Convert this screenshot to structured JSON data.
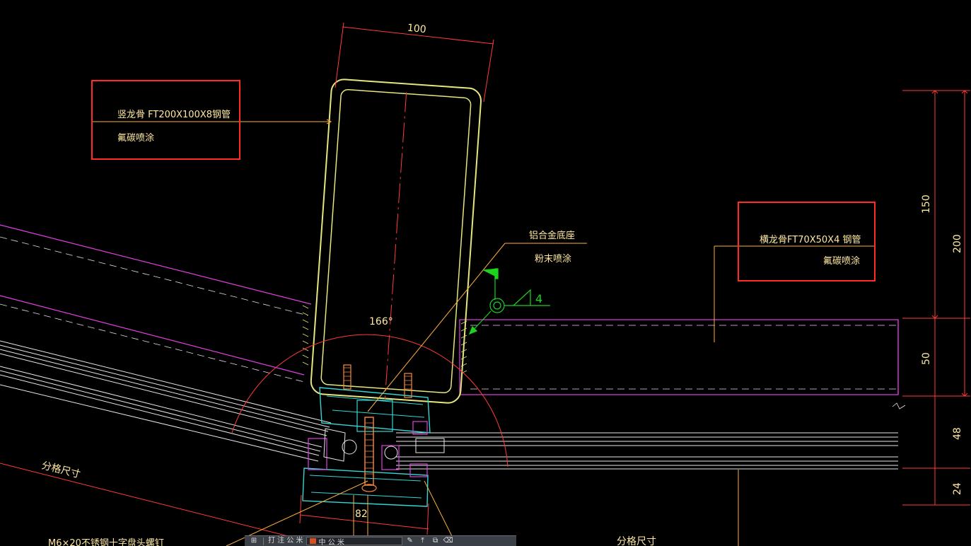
{
  "colors": {
    "background": "#000000",
    "steel": "#e6e67e",
    "dimension": "#ff3a3a",
    "leader": "#ffb13a",
    "text": "#ffe9a0",
    "magenta": "#e040e0",
    "cyan": "#34d6d6",
    "green": "#1bd41b",
    "highlight_box": "#ff2a2a"
  },
  "dimensions": {
    "width_top": "100",
    "angle": "166°",
    "right_150": "150",
    "right_200": "200",
    "right_50": "50",
    "right_48": "48",
    "right_24": "24",
    "bottom_82": "82",
    "weld_size": "4"
  },
  "annotations": {
    "vertical_member_line1": "竖龙骨 FT200X100X8钢管",
    "vertical_member_line2": "氟碳喷涂",
    "horizontal_member_line1": "横龙骨FT70X50X4 钢管",
    "horizontal_member_line2": "氟碳喷涂",
    "base_line1": "铝合金底座",
    "base_line2": "粉末喷涂",
    "grid_left": "分格尺寸",
    "grid_bottom": "分格尺寸",
    "bolt": "M6×20不锈钢十字盘头螺钉"
  },
  "toolbar": {
    "icons": [
      "layers-icon",
      "draw-icon",
      "move-icon",
      "copy-icon",
      "erase-icon"
    ],
    "layer_prefix": "打 注 公 米",
    "current_layer": "中 公 米",
    "layer_color": "#d9501e"
  }
}
